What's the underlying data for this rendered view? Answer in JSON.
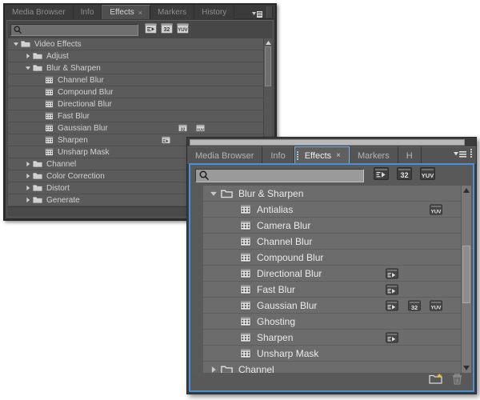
{
  "back_panel": {
    "tabs": [
      {
        "label": "Media Browser",
        "active": false,
        "closable": false
      },
      {
        "label": "Info",
        "active": false,
        "closable": false
      },
      {
        "label": "Effects",
        "active": true,
        "closable": true,
        "close_glyph": "×"
      },
      {
        "label": "Markers",
        "active": false,
        "closable": false
      },
      {
        "label": "History",
        "active": false,
        "closable": false
      }
    ],
    "panel_menu_name": "panel-menu-icon",
    "search": {
      "value": "",
      "placeholder": "",
      "icon": "search-icon"
    },
    "filters": [
      {
        "name": "accelerated-effects-filter",
        "label": "≡▶",
        "active": false
      },
      {
        "name": "32bit-effects-filter",
        "label": "32",
        "active": false
      },
      {
        "name": "yuv-effects-filter",
        "label": "YUV",
        "active": false
      }
    ],
    "tree": [
      {
        "label": "Video Effects",
        "type": "folder",
        "depth": 0,
        "expanded": true,
        "badges": []
      },
      {
        "label": "Adjust",
        "type": "folder",
        "depth": 1,
        "expanded": false,
        "badges": []
      },
      {
        "label": "Blur & Sharpen",
        "type": "folder",
        "depth": 1,
        "expanded": true,
        "badges": []
      },
      {
        "label": "Channel Blur",
        "type": "effect",
        "depth": 2,
        "badges": []
      },
      {
        "label": "Compound Blur",
        "type": "effect",
        "depth": 2,
        "badges": []
      },
      {
        "label": "Directional Blur",
        "type": "effect",
        "depth": 2,
        "badges": []
      },
      {
        "label": "Fast Blur",
        "type": "effect",
        "depth": 2,
        "badges": []
      },
      {
        "label": "Gaussian Blur",
        "type": "effect",
        "depth": 2,
        "badges": [
          "32",
          "YUV"
        ]
      },
      {
        "label": "Sharpen",
        "type": "effect",
        "depth": 2,
        "badges": [
          "ACC"
        ]
      },
      {
        "label": "Unsharp Mask",
        "type": "effect",
        "depth": 2,
        "badges": []
      },
      {
        "label": "Channel",
        "type": "folder",
        "depth": 1,
        "expanded": false,
        "badges": []
      },
      {
        "label": "Color Correction",
        "type": "folder",
        "depth": 1,
        "expanded": false,
        "badges": []
      },
      {
        "label": "Distort",
        "type": "folder",
        "depth": 1,
        "expanded": false,
        "badges": []
      },
      {
        "label": "Generate",
        "type": "folder",
        "depth": 1,
        "expanded": false,
        "badges": []
      }
    ]
  },
  "front_panel": {
    "tabs": [
      {
        "label": "Media Browser",
        "active": false,
        "closable": false
      },
      {
        "label": "Info",
        "active": false,
        "closable": false
      },
      {
        "label": "Effects",
        "active": true,
        "closable": true,
        "close_glyph": "×"
      },
      {
        "label": "Markers",
        "active": false,
        "closable": false
      },
      {
        "label": "H",
        "active": false,
        "closable": false,
        "clipped": true
      }
    ],
    "panel_menu_name": "panel-menu-icon",
    "search": {
      "value": "",
      "placeholder": "",
      "icon": "search-icon"
    },
    "filters": [
      {
        "name": "accelerated-effects-filter",
        "label": "≡▶",
        "active": false
      },
      {
        "name": "32bit-effects-filter",
        "label": "32",
        "active": false
      },
      {
        "name": "yuv-effects-filter",
        "label": "YUV",
        "active": false
      }
    ],
    "tree": [
      {
        "label": "Blur & Sharpen",
        "type": "folder",
        "depth": 0,
        "expanded": true,
        "badges": []
      },
      {
        "label": "Antialias",
        "type": "effect",
        "depth": 1,
        "badges": [
          "YUV"
        ]
      },
      {
        "label": "Camera Blur",
        "type": "effect",
        "depth": 1,
        "badges": []
      },
      {
        "label": "Channel Blur",
        "type": "effect",
        "depth": 1,
        "badges": []
      },
      {
        "label": "Compound Blur",
        "type": "effect",
        "depth": 1,
        "badges": []
      },
      {
        "label": "Directional Blur",
        "type": "effect",
        "depth": 1,
        "badges": [
          "ACC"
        ]
      },
      {
        "label": "Fast Blur",
        "type": "effect",
        "depth": 1,
        "badges": [
          "ACC"
        ]
      },
      {
        "label": "Gaussian Blur",
        "type": "effect",
        "depth": 1,
        "badges": [
          "ACC",
          "32",
          "YUV"
        ]
      },
      {
        "label": "Ghosting",
        "type": "effect",
        "depth": 1,
        "badges": []
      },
      {
        "label": "Sharpen",
        "type": "effect",
        "depth": 1,
        "badges": [
          "ACC"
        ]
      },
      {
        "label": "Unsharp Mask",
        "type": "effect",
        "depth": 1,
        "badges": []
      },
      {
        "label": "Channel",
        "type": "folder",
        "depth": 0,
        "expanded": false,
        "badges": []
      }
    ],
    "footer": [
      {
        "name": "new-custom-bin-icon",
        "enabled": true
      },
      {
        "name": "delete-custom-item-icon",
        "enabled": false
      }
    ],
    "scrollbar": {
      "up_glyph": "▲",
      "down_glyph": "▼"
    }
  },
  "colors": {
    "accent_blue": "#4a90d9",
    "panel_bg": "#595959",
    "row_bg": "#6c6c6c",
    "badge_bg": "#4a4a4a",
    "star_yellow": "#f2c230"
  }
}
